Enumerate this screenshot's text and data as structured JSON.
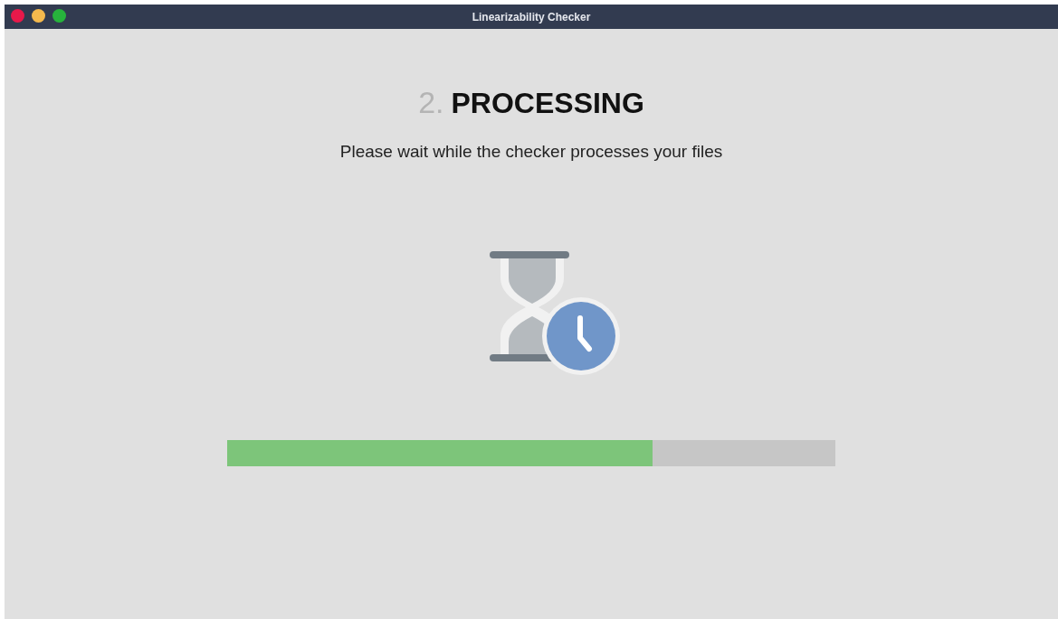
{
  "window": {
    "title": "Linearizability Checker"
  },
  "heading": {
    "step": "2.",
    "title": "PROCESSING"
  },
  "message": "Please wait while the checker processes your files",
  "progress": {
    "level": 0.7
  }
}
